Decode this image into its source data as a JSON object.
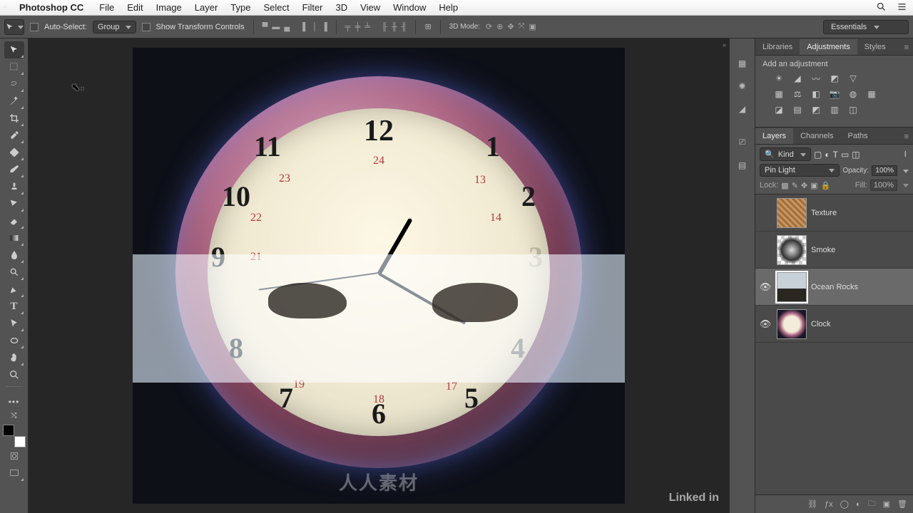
{
  "menubar": {
    "app": "Photoshop CC",
    "items": [
      "File",
      "Edit",
      "Image",
      "Layer",
      "Type",
      "Select",
      "Filter",
      "3D",
      "View",
      "Window",
      "Help"
    ]
  },
  "optbar": {
    "autoSelectLabel": "Auto-Select:",
    "autoSelectMode": "Group",
    "showTransform": "Show Transform Controls",
    "mode3d": "3D Mode:",
    "workspace": "Essentials"
  },
  "adjustments": {
    "tabs": [
      "Libraries",
      "Adjustments",
      "Styles"
    ],
    "activeTab": 1,
    "addLabel": "Add an adjustment"
  },
  "layersPanel": {
    "tabs": [
      "Layers",
      "Channels",
      "Paths"
    ],
    "activeTab": 0,
    "filterKind": "Kind",
    "blendMode": "Pin Light",
    "opacityLabel": "Opacity:",
    "opacityValue": "100%",
    "lockLabel": "Lock:",
    "fillLabel": "Fill:",
    "fillValue": "100%",
    "layers": [
      {
        "name": "Texture",
        "visible": false,
        "selected": false,
        "thumb": "texture"
      },
      {
        "name": "Smoke",
        "visible": false,
        "selected": false,
        "thumb": "smoke"
      },
      {
        "name": "Ocean Rocks",
        "visible": true,
        "selected": true,
        "thumb": "ocean"
      },
      {
        "name": "Clock",
        "visible": true,
        "selected": false,
        "thumb": "clock"
      }
    ]
  },
  "clockNumbers": {
    "n1": "1",
    "n2": "2",
    "n3": "3",
    "n4": "4",
    "n5": "5",
    "n6": "6",
    "n7": "7",
    "n8": "8",
    "n9": "9",
    "n10": "10",
    "n11": "11",
    "n12": "12"
  },
  "clockRed": {
    "r13": "13",
    "r14": "14",
    "r17": "17",
    "r18": "18",
    "r19": "19",
    "r21": "21",
    "r22": "22",
    "r23": "23",
    "r24": "24"
  },
  "watermark": "人人素材",
  "brandFooter": "Linked in"
}
